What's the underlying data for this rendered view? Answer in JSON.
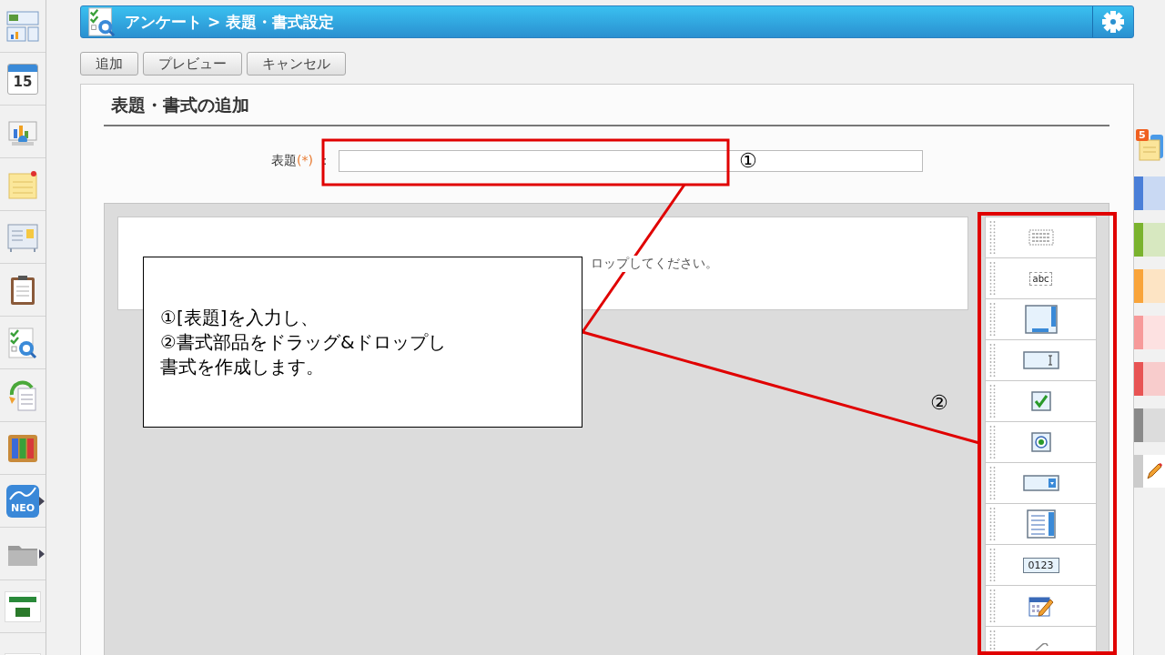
{
  "sidebar": {
    "items": [
      {
        "kind": "dashboard",
        "submenu": false
      },
      {
        "kind": "calendar",
        "label": "15",
        "submenu": false
      },
      {
        "kind": "chart",
        "submenu": false
      },
      {
        "kind": "memo",
        "submenu": false
      },
      {
        "kind": "board",
        "submenu": false
      },
      {
        "kind": "clipboard",
        "submenu": false
      },
      {
        "kind": "survey",
        "submenu": false
      },
      {
        "kind": "workflow",
        "submenu": false
      },
      {
        "kind": "binders",
        "submenu": false
      },
      {
        "kind": "neo",
        "label": "NEO",
        "submenu": true
      },
      {
        "kind": "folder",
        "submenu": true
      },
      {
        "kind": "logo",
        "submenu": false
      },
      {
        "kind": "banner",
        "submenu": false
      }
    ]
  },
  "header": {
    "title": "アンケート > 表題・書式設定"
  },
  "toolbar": {
    "buttons": [
      "追加",
      "プレビュー",
      "キャンセル"
    ]
  },
  "panel": {
    "title": "表題・書式の追加",
    "form": {
      "label": "表題",
      "required": "(*)",
      "colon": "："
    },
    "drop_zone": {
      "text": "ロップしてください。"
    },
    "palette": [
      {
        "kind": "text-block"
      },
      {
        "kind": "label",
        "label": "abc"
      },
      {
        "kind": "textarea"
      },
      {
        "kind": "textbox"
      },
      {
        "kind": "checkbox"
      },
      {
        "kind": "radio"
      },
      {
        "kind": "select"
      },
      {
        "kind": "listbox"
      },
      {
        "kind": "number",
        "label": "0123"
      },
      {
        "kind": "date"
      },
      {
        "kind": "attachment"
      }
    ]
  },
  "right_strip": {
    "badge": "5",
    "color_tabs": [
      {
        "color": "#4a7fd8"
      },
      {
        "color": "#7ab32e"
      },
      {
        "color": "#f9a43a"
      },
      {
        "color": "#f79a9a"
      },
      {
        "color": "#e85454"
      },
      {
        "color": "#8a8a8a"
      }
    ]
  },
  "annotations": {
    "marks": [
      "①",
      "②"
    ],
    "callout": [
      "①[表題]を入力し、",
      "②書式部品をドラッグ&ドロップし",
      "書式を作成します。"
    ]
  }
}
